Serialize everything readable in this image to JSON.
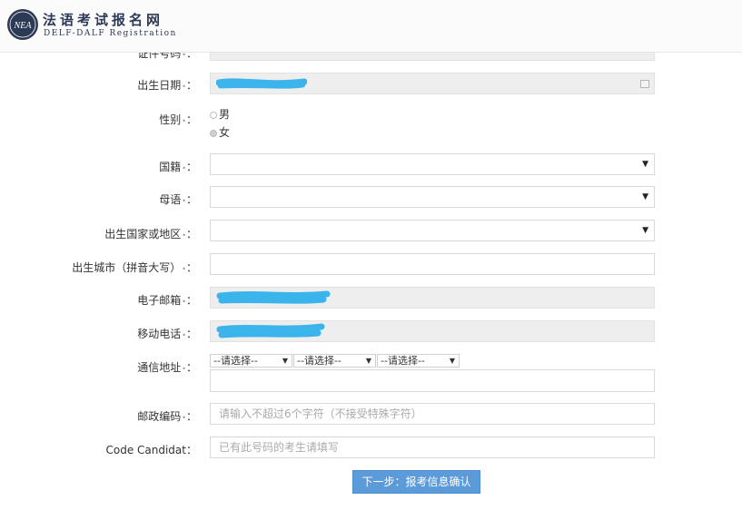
{
  "header": {
    "title": "法语考试报名网",
    "subtitle": "DELF-DALF Registration",
    "badge_text": "NEA"
  },
  "form": {
    "id_number": {
      "label": "证件号码",
      "value": ""
    },
    "birth_date": {
      "label": "出生日期",
      "value": ""
    },
    "gender": {
      "label": "性别",
      "options": [
        "男",
        "女"
      ],
      "selected": "女"
    },
    "nationality": {
      "label": "国籍",
      "value": ""
    },
    "mother_tongue": {
      "label": "母语",
      "value": ""
    },
    "birth_country": {
      "label": "出生国家或地区",
      "value": ""
    },
    "birth_city": {
      "label": "出生城市（拼音大写）",
      "value": ""
    },
    "email": {
      "label": "电子邮箱",
      "value": ""
    },
    "mobile": {
      "label": "移动电话",
      "value": ""
    },
    "address": {
      "label": "通信地址",
      "province": "--请选择--",
      "city": "--请选择--",
      "district": "--请选择--",
      "detail": ""
    },
    "postal_code": {
      "label": "邮政编码",
      "placeholder": "请输入不超过6个字符（不接受特殊字符）"
    },
    "candidate_code": {
      "label": "Code Candidat",
      "placeholder": "已有此号码的考生请填写"
    },
    "colon": "：",
    "required_mark": "•"
  },
  "actions": {
    "next_label": "下一步：报考信息确认"
  },
  "colors": {
    "accent": "#5b9bd9",
    "scribble": "#3ab4ea"
  }
}
